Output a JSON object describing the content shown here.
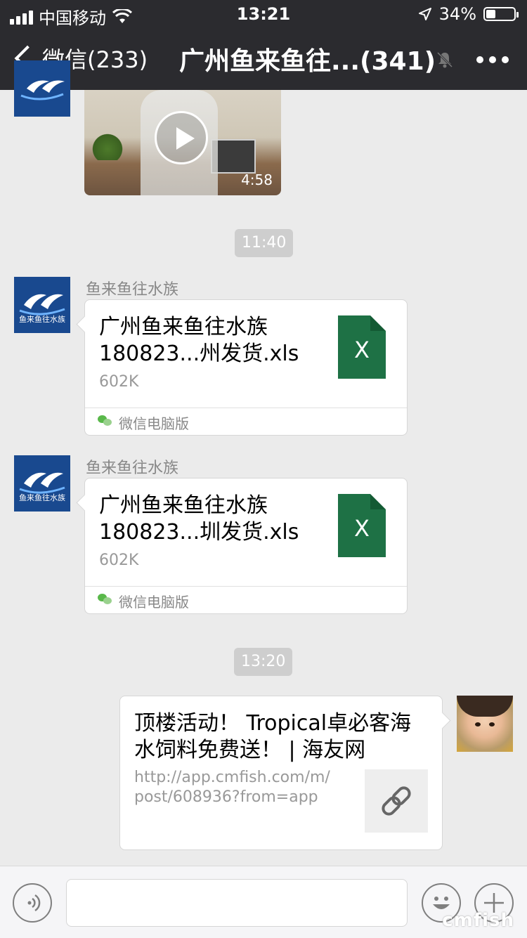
{
  "status_bar": {
    "carrier": "中国移动",
    "time": "13:21",
    "battery": "34%",
    "battery_level": 0.34
  },
  "navbar": {
    "back_label": "微信(233)",
    "title": "广州鱼来鱼往...(341)"
  },
  "messages": [
    {
      "type": "video",
      "duration": "4:58"
    },
    {
      "type": "time",
      "text": "11:40"
    },
    {
      "type": "file",
      "sender": "鱼来鱼往水族",
      "avatar_text": "鱼来鱼往水族",
      "file_name": "广州鱼来鱼往水族180823...州发货.xls",
      "file_name_line1": "广州鱼来鱼往水族",
      "file_name_line2": "180823...州发货.xls",
      "size": "602K",
      "icon_letter": "X",
      "source": "微信电脑版"
    },
    {
      "type": "file",
      "sender": "鱼来鱼往水族",
      "avatar_text": "鱼来鱼往水族",
      "file_name_line1": "广州鱼来鱼往水族",
      "file_name_line2": "180823...圳发货.xls",
      "size": "602K",
      "icon_letter": "X",
      "source": "微信电脑版"
    },
    {
      "type": "time",
      "text": "13:20"
    },
    {
      "type": "link",
      "title_line1": "顶楼活动！ Tropical卓必客海",
      "title_line2": "水饲料免费送！ | 海友网",
      "url_line1": "http://app.cmfish.com/m/",
      "url_line2": "post/608936?from=app"
    }
  ],
  "watermark": "cmfish",
  "icons": {
    "back": "chevron-left-icon",
    "mute": "bell-off-icon",
    "more": "more-horizontal-icon",
    "voice": "voice-icon",
    "emoji": "emoji-icon",
    "plus": "plus-icon",
    "link": "link-icon",
    "excel": "excel-file-icon"
  },
  "colors": {
    "navbar_bg": "#2b2b2f",
    "chat_bg": "#ebebeb",
    "excel_green": "#1e7145",
    "logo_blue": "#19498f",
    "wechat_green": "#59b84a"
  }
}
